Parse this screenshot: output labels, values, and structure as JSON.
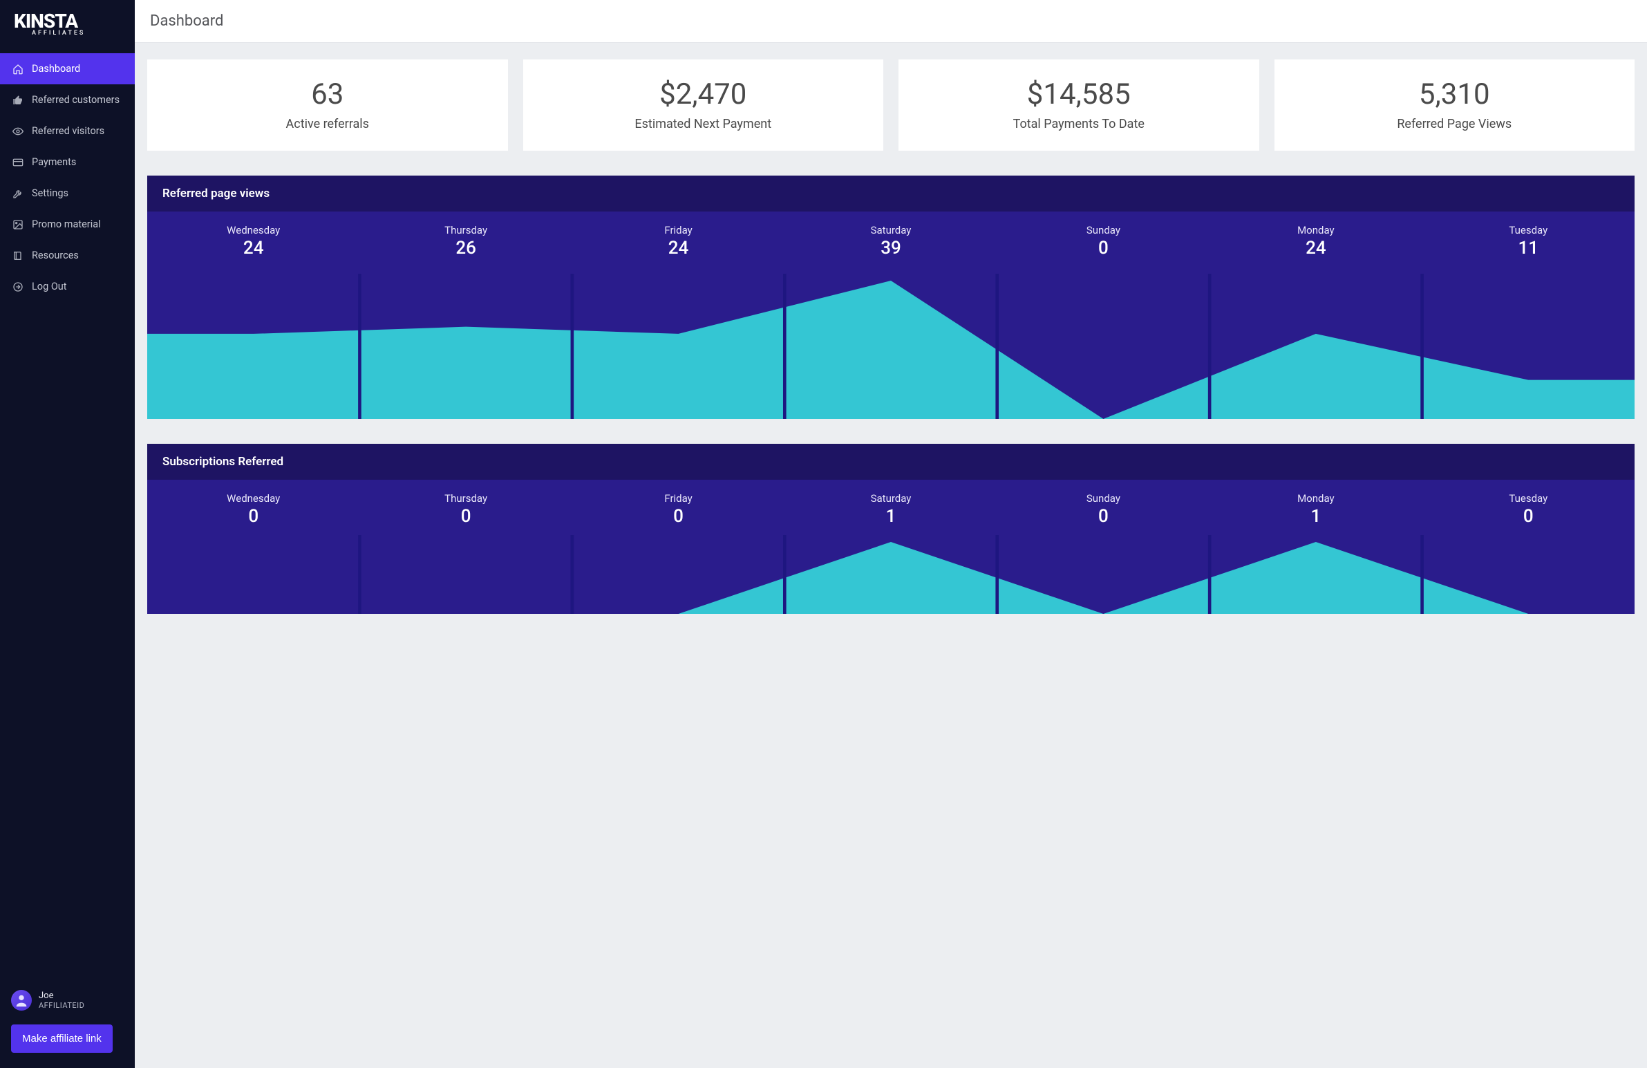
{
  "brand": {
    "name": "KINSTA",
    "sub": "AFFILIATES"
  },
  "nav": {
    "items": [
      {
        "label": "Dashboard"
      },
      {
        "label": "Referred customers"
      },
      {
        "label": "Referred visitors"
      },
      {
        "label": "Payments"
      },
      {
        "label": "Settings"
      },
      {
        "label": "Promo material"
      },
      {
        "label": "Resources"
      },
      {
        "label": "Log Out"
      }
    ]
  },
  "user": {
    "name": "Joe",
    "affiliate_id": "AFFILIATEID"
  },
  "actions": {
    "make_link": "Make affiliate link"
  },
  "page": {
    "title": "Dashboard"
  },
  "stats": [
    {
      "value": "63",
      "label": "Active referrals"
    },
    {
      "value": "$2,470",
      "label": "Estimated Next Payment"
    },
    {
      "value": "$14,585",
      "label": "Total Payments To Date"
    },
    {
      "value": "5,310",
      "label": "Referred Page Views"
    }
  ],
  "charts": {
    "pageviews": {
      "title": "Referred page views"
    },
    "subscriptions": {
      "title": "Subscriptions Referred"
    }
  },
  "chart_data": [
    {
      "type": "area",
      "title": "Referred page views",
      "categories": [
        "Wednesday",
        "Thursday",
        "Friday",
        "Saturday",
        "Sunday",
        "Monday",
        "Tuesday"
      ],
      "values": [
        24,
        26,
        24,
        39,
        0,
        24,
        11
      ],
      "ylim": [
        0,
        39
      ]
    },
    {
      "type": "area",
      "title": "Subscriptions Referred",
      "categories": [
        "Wednesday",
        "Thursday",
        "Friday",
        "Saturday",
        "Sunday",
        "Monday",
        "Tuesday"
      ],
      "values": [
        0,
        0,
        0,
        1,
        0,
        1,
        0
      ],
      "ylim": [
        0,
        1
      ]
    }
  ]
}
